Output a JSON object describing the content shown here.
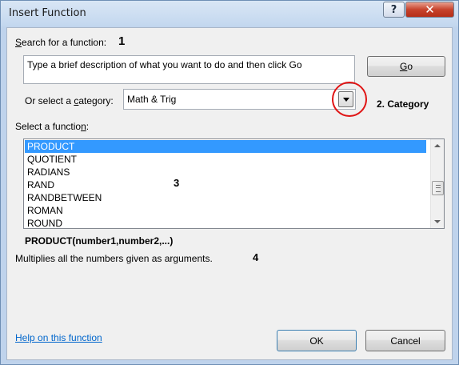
{
  "window": {
    "title": "Insert Function",
    "help_glyph": "?",
    "close_glyph": "✕"
  },
  "search": {
    "label_prefix": "",
    "label_underlined": "S",
    "label_suffix": "earch for a function:",
    "annotation": "1",
    "value": "Type a brief description of what you want to do and then click Go",
    "go_prefix": "",
    "go_underlined": "G",
    "go_suffix": "o"
  },
  "category": {
    "label_prefix": "Or select a ",
    "label_underlined": "c",
    "label_suffix": "ategory:",
    "selected": "Math & Trig",
    "annotation": "2. Category",
    "highlight_color": "#e01414"
  },
  "functions": {
    "label_prefix": "Select a functio",
    "label_underlined": "n",
    "label_suffix": ":",
    "annotation": "3",
    "items": [
      "PRODUCT",
      "QUOTIENT",
      "RADIANS",
      "RAND",
      "RANDBETWEEN",
      "ROMAN",
      "ROUND"
    ],
    "selected_index": 0,
    "selection_color": "#3399ff"
  },
  "description": {
    "syntax": "PRODUCT(number1,number2,...)",
    "text": "Multiplies all the numbers given as arguments.",
    "annotation": "4"
  },
  "footer": {
    "help_link": "Help on this function",
    "ok_label": "OK",
    "cancel_label": "Cancel"
  }
}
